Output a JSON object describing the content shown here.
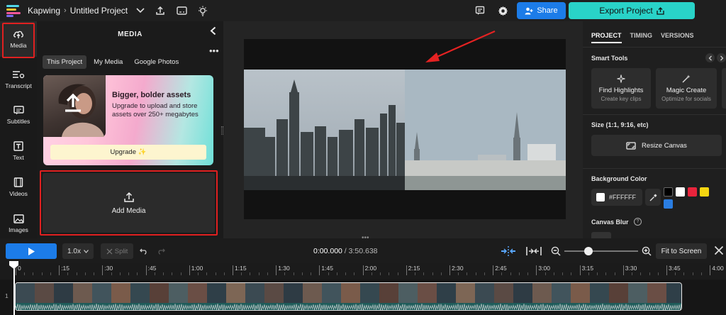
{
  "topbar": {
    "brand": "Kapwing",
    "project_title": "Untitled Project",
    "share_label": "Share",
    "export_label": "Export Project"
  },
  "rail": {
    "items": [
      {
        "label": "Media",
        "icon": "upload-cloud-icon"
      },
      {
        "label": "Transcript",
        "icon": "transcript-icon"
      },
      {
        "label": "Subtitles",
        "icon": "subtitles-icon"
      },
      {
        "label": "Text",
        "icon": "text-icon"
      },
      {
        "label": "Videos",
        "icon": "film-icon"
      },
      {
        "label": "Images",
        "icon": "image-icon"
      }
    ]
  },
  "media_panel": {
    "title": "MEDIA",
    "tabs": [
      "This Project",
      "My Media",
      "Google Photos"
    ],
    "promo": {
      "headline": "Bigger, bolder assets",
      "text": "Upgrade to upload and store assets over 250+ megabytes",
      "button": "Upgrade ✨"
    },
    "add_media_label": "Add Media"
  },
  "right_panel": {
    "tabs": [
      "PROJECT",
      "TIMING",
      "VERSIONS"
    ],
    "smart_tools_label": "Smart Tools",
    "cards": [
      {
        "title": "Find Highlights",
        "subtitle": "Create key clips"
      },
      {
        "title": "Magic Create",
        "subtitle": "Optimize for socials"
      }
    ],
    "size_label": "Size (1:1, 9:16, etc)",
    "resize_label": "Resize Canvas",
    "bg_color_label": "Background Color",
    "bg_color_value": "#FFFFFF",
    "swatches": [
      "#000000",
      "#ffffff",
      "#e8243c",
      "#f5d611",
      "#2a7de1"
    ],
    "canvas_blur_label": "Canvas Blur"
  },
  "timeline": {
    "speed": "1.0x",
    "split_label": "Split",
    "current_time": "0:00.000",
    "total_time": "3:50.638",
    "fit_label": "Fit to Screen",
    "track_number": "1",
    "ticks": [
      "0",
      ":15",
      ":30",
      ":45",
      "1:00",
      "1:15",
      "1:30",
      "1:45",
      "2:00",
      "2:15",
      "2:30",
      "2:45",
      "3:00",
      "3:15",
      "3:30",
      "3:45",
      "4:00"
    ]
  },
  "colors": {
    "accent_blue": "#1c7ce8",
    "export_teal": "#29d3c8",
    "highlight_red": "#e02020"
  }
}
